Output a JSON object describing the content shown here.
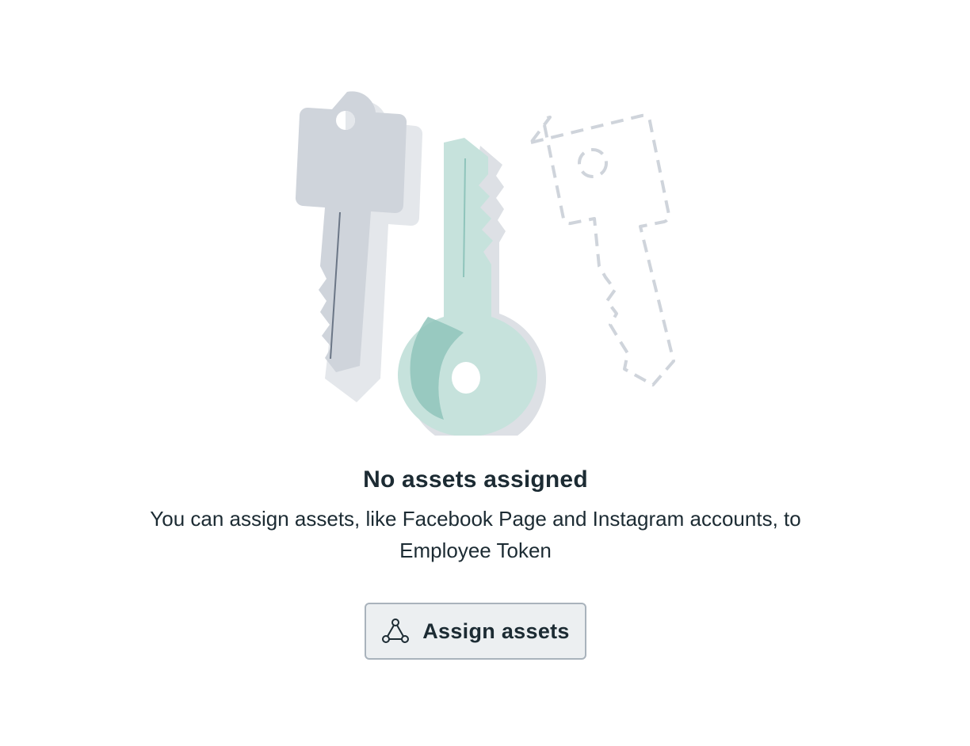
{
  "empty_state": {
    "title": "No assets assigned",
    "description": "You can assign assets, like Facebook Page and Instagram accounts, to Employee Token"
  },
  "button": {
    "label": "Assign assets",
    "icon": "assets-nodes-icon"
  },
  "colors": {
    "gray_key": "#cfd4db",
    "teal_key": "#c6e2dc",
    "teal_texture": "#8fc4bb",
    "text": "#1c2b33",
    "button_bg": "#eceff1",
    "button_border": "#a9b3bc"
  }
}
